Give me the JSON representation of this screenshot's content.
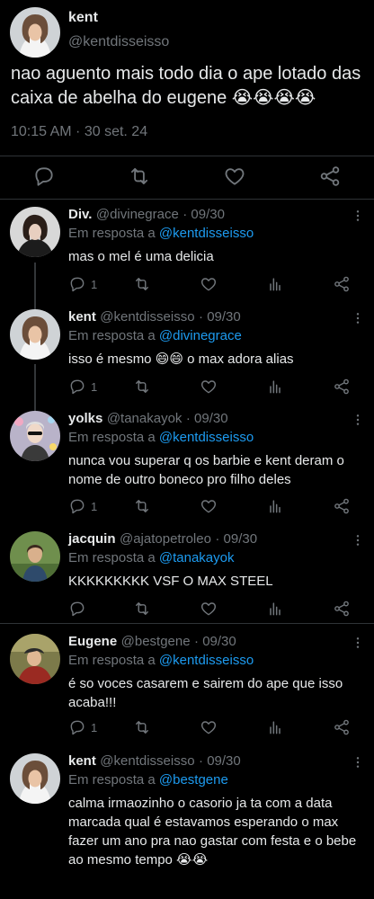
{
  "main_tweet": {
    "name": "kent",
    "handle": "@kentdisseisso",
    "text": "nao aguento mais todo dia o ape lotado das caixa de abelha do eugene 😭😭😭😭",
    "timestamp": "10:15 AM · 30 set. 24"
  },
  "replies": [
    {
      "name": "Div.",
      "handle": "@divinegrace",
      "date": "· 09/30",
      "in_reply_prefix": "Em resposta a",
      "in_reply_to": "@kentdisseisso",
      "text": "mas o mel é uma delicia",
      "reply_count": "1"
    },
    {
      "name": "kent",
      "handle": "@kentdisseisso",
      "date": "· 09/30",
      "in_reply_prefix": "Em resposta a",
      "in_reply_to": "@divinegrace",
      "text": "isso é mesmo 😄😄 o max adora alias",
      "reply_count": "1"
    },
    {
      "name": "yolks",
      "handle": "@tanakayok",
      "date": "· 09/30",
      "in_reply_prefix": "Em resposta a",
      "in_reply_to": "@kentdisseisso",
      "text": "nunca vou superar q os barbie e kent deram o nome de outro boneco pro filho deles",
      "reply_count": "1"
    },
    {
      "name": "jacquin",
      "handle": "@ajatopetroleo",
      "date": "· 09/30",
      "in_reply_prefix": "Em resposta a",
      "in_reply_to": "@tanakayok",
      "text": "KKKKKKKKK VSF O MAX STEEL",
      "reply_count": ""
    },
    {
      "name": "Eugene",
      "handle": "@bestgene",
      "date": "· 09/30",
      "in_reply_prefix": "Em resposta a",
      "in_reply_to": "@kentdisseisso",
      "text": "é so voces casarem e sairem do ape que isso acaba!!!",
      "reply_count": "1"
    },
    {
      "name": "kent",
      "handle": "@kentdisseisso",
      "date": "· 09/30",
      "in_reply_prefix": "Em resposta a",
      "in_reply_to": "@bestgene",
      "text": "calma irmaozinho o casorio ja ta com a data marcada qual é estavamos esperando o max fazer um ano pra nao gastar com festa e o bebe ao mesmo tempo 😭😭",
      "reply_count": ""
    }
  ],
  "colors": {
    "background": "#000000",
    "text": "#e7e9ea",
    "muted": "#71767b",
    "mention": "#1d9bf0",
    "divider": "#2f3336"
  },
  "icons": [
    "reply-icon",
    "retweet-icon",
    "like-icon",
    "views-icon",
    "share-icon",
    "more-icon"
  ]
}
